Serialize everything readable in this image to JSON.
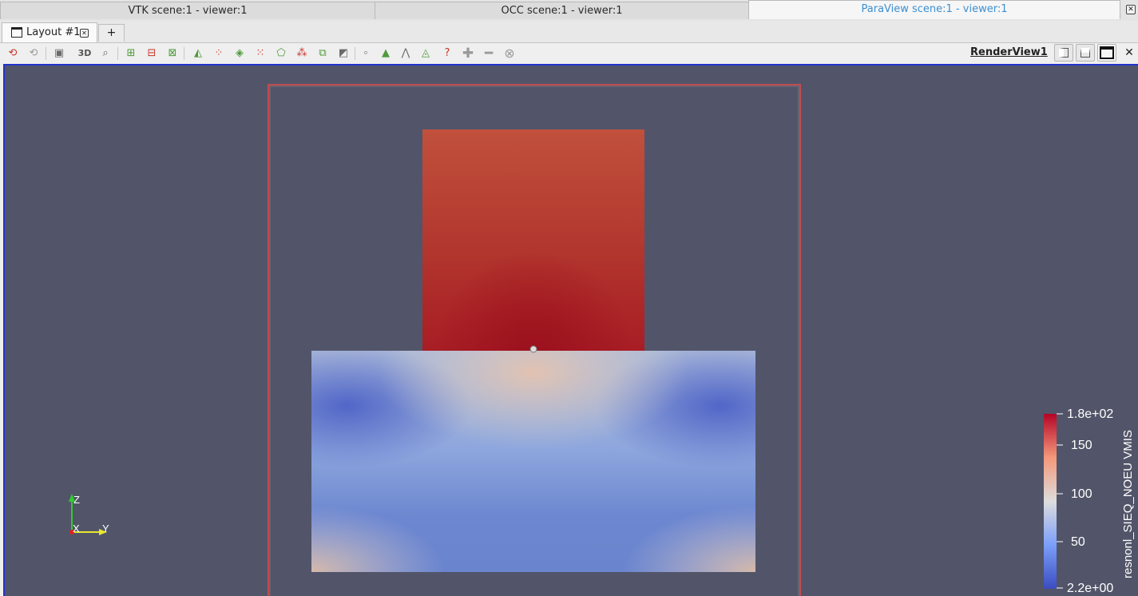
{
  "viewer_tabs": [
    {
      "label": "VTK scene:1 - viewer:1",
      "active": false
    },
    {
      "label": "OCC scene:1 - viewer:1",
      "active": false
    },
    {
      "label": "ParaView scene:1 - viewer:1",
      "active": true
    }
  ],
  "layout_tabs": {
    "current": "Layout #1",
    "add_label": "+"
  },
  "toolbar": {
    "three_d_label": "3D",
    "view_name": "RenderView1",
    "icons": [
      "reset-camera-icon",
      "reset-camera-closest-icon",
      "screenshot-icon",
      "toggle-3d-icon",
      "zoom-to-data-icon",
      "zoom-in-icon",
      "zoom-out-icon",
      "zoom-closest-icon",
      "select-surface-cells-icon",
      "select-surface-points-icon",
      "select-frustum-cells-icon",
      "select-frustum-points-icon",
      "select-polygon-cells-icon",
      "select-polygon-points-icon",
      "select-block-icon",
      "interactive-select-icon",
      "hover-points-icon",
      "hover-cells-icon",
      "pick-point-icon",
      "grow-selection-icon",
      "query-icon",
      "add-selection-icon",
      "subtract-selection-icon",
      "clear-selection-icon"
    ]
  },
  "render_view": {
    "background": "#525569",
    "outline_color": "#e34b4b",
    "colorbar": {
      "title": "resnonl_SIEQ_NOEU VMIS",
      "ticks": [
        "1.8e+02",
        "150",
        "100",
        "50",
        "2.2e+00"
      ],
      "range": [
        2.2,
        180
      ],
      "colormap": "Cool to Warm",
      "low_color": "#3b4cc0",
      "mid_color": "#dddddd",
      "high_color": "#b40426"
    },
    "orientation_axes": {
      "z_label": "Z",
      "x_label": "X",
      "y_label": "Y",
      "z_color": "#2ecc2e",
      "y_color": "#e8e82e",
      "x_color": "#e02020"
    }
  }
}
